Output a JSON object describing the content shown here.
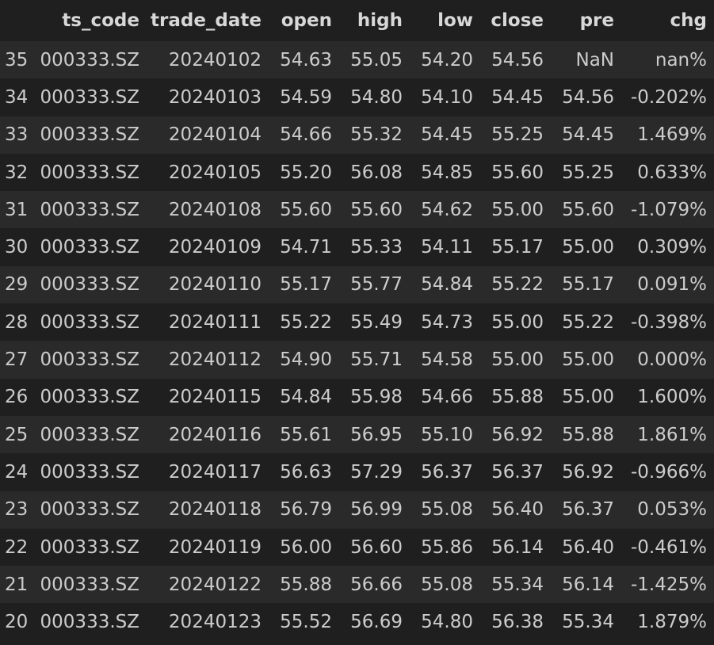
{
  "table": {
    "columns": [
      "",
      "ts_code",
      "trade_date",
      "open",
      "high",
      "low",
      "close",
      "pre",
      "chg"
    ],
    "rows": [
      [
        "35",
        "000333.SZ",
        "20240102",
        "54.63",
        "55.05",
        "54.20",
        "54.56",
        "NaN",
        "nan%"
      ],
      [
        "34",
        "000333.SZ",
        "20240103",
        "54.59",
        "54.80",
        "54.10",
        "54.45",
        "54.56",
        "-0.202%"
      ],
      [
        "33",
        "000333.SZ",
        "20240104",
        "54.66",
        "55.32",
        "54.45",
        "55.25",
        "54.45",
        "1.469%"
      ],
      [
        "32",
        "000333.SZ",
        "20240105",
        "55.20",
        "56.08",
        "54.85",
        "55.60",
        "55.25",
        "0.633%"
      ],
      [
        "31",
        "000333.SZ",
        "20240108",
        "55.60",
        "55.60",
        "54.62",
        "55.00",
        "55.60",
        "-1.079%"
      ],
      [
        "30",
        "000333.SZ",
        "20240109",
        "54.71",
        "55.33",
        "54.11",
        "55.17",
        "55.00",
        "0.309%"
      ],
      [
        "29",
        "000333.SZ",
        "20240110",
        "55.17",
        "55.77",
        "54.84",
        "55.22",
        "55.17",
        "0.091%"
      ],
      [
        "28",
        "000333.SZ",
        "20240111",
        "55.22",
        "55.49",
        "54.73",
        "55.00",
        "55.22",
        "-0.398%"
      ],
      [
        "27",
        "000333.SZ",
        "20240112",
        "54.90",
        "55.71",
        "54.58",
        "55.00",
        "55.00",
        "0.000%"
      ],
      [
        "26",
        "000333.SZ",
        "20240115",
        "54.84",
        "55.98",
        "54.66",
        "55.88",
        "55.00",
        "1.600%"
      ],
      [
        "25",
        "000333.SZ",
        "20240116",
        "55.61",
        "56.95",
        "55.10",
        "56.92",
        "55.88",
        "1.861%"
      ],
      [
        "24",
        "000333.SZ",
        "20240117",
        "56.63",
        "57.29",
        "56.37",
        "56.37",
        "56.92",
        "-0.966%"
      ],
      [
        "23",
        "000333.SZ",
        "20240118",
        "56.79",
        "56.99",
        "55.08",
        "56.40",
        "56.37",
        "0.053%"
      ],
      [
        "22",
        "000333.SZ",
        "20240119",
        "56.00",
        "56.60",
        "55.86",
        "56.14",
        "56.40",
        "-0.461%"
      ],
      [
        "21",
        "000333.SZ",
        "20240122",
        "55.88",
        "56.66",
        "55.08",
        "55.34",
        "56.14",
        "-1.425%"
      ],
      [
        "20",
        "000333.SZ",
        "20240123",
        "55.52",
        "56.69",
        "54.80",
        "56.38",
        "55.34",
        "1.879%"
      ]
    ]
  }
}
